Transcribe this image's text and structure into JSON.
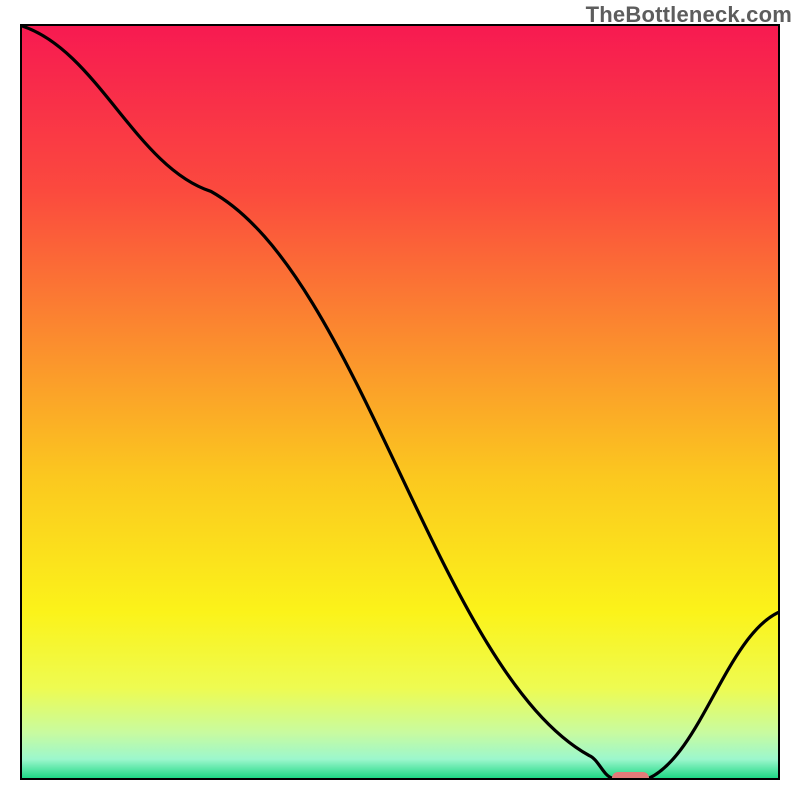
{
  "watermark": "TheBottleneck.com",
  "chart_data": {
    "type": "line",
    "title": "",
    "xlabel": "",
    "ylabel": "",
    "xlim": [
      0,
      100
    ],
    "ylim": [
      0,
      100
    ],
    "x": [
      0,
      25,
      75,
      78,
      83,
      100
    ],
    "values": [
      100,
      78,
      3,
      0,
      0,
      22
    ],
    "marker": {
      "x_start": 78,
      "x_end": 83,
      "y": 0
    },
    "gradient_stops": [
      {
        "offset": 0,
        "color": "#f71a51"
      },
      {
        "offset": 0.22,
        "color": "#fb4a3e"
      },
      {
        "offset": 0.42,
        "color": "#fb8d2e"
      },
      {
        "offset": 0.6,
        "color": "#fbc81f"
      },
      {
        "offset": 0.78,
        "color": "#fbf31a"
      },
      {
        "offset": 0.88,
        "color": "#eefb51"
      },
      {
        "offset": 0.94,
        "color": "#c8fba0"
      },
      {
        "offset": 0.975,
        "color": "#9cf7cd"
      },
      {
        "offset": 1.0,
        "color": "#1fd885"
      }
    ]
  }
}
